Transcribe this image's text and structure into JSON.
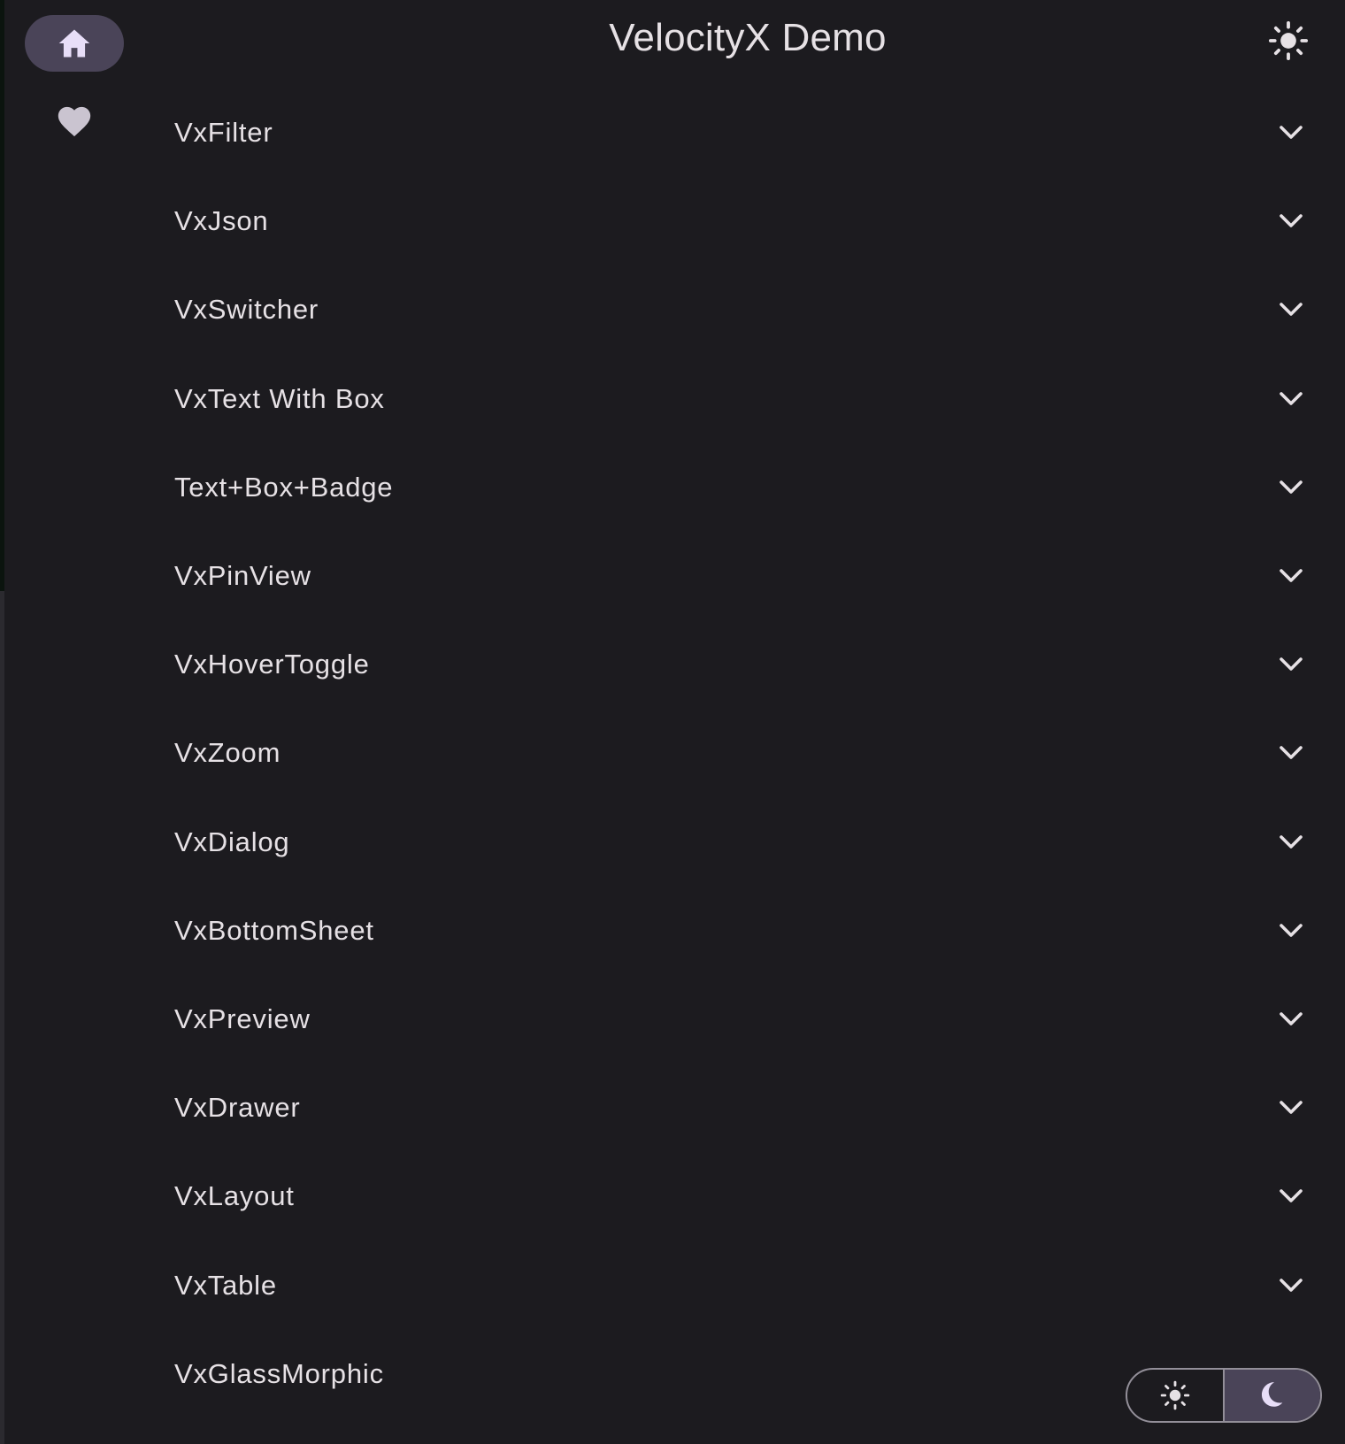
{
  "app": {
    "title": "VelocityX Demo"
  },
  "nav_rail": {
    "items": [
      {
        "icon": "home-icon",
        "selected": true
      },
      {
        "icon": "heart-icon",
        "selected": false
      }
    ]
  },
  "header": {
    "theme_icon": "sun-icon"
  },
  "list": {
    "items": [
      {
        "label": "VxFilter"
      },
      {
        "label": "VxJson"
      },
      {
        "label": "VxSwitcher"
      },
      {
        "label": "VxText With Box"
      },
      {
        "label": "Text+Box+Badge"
      },
      {
        "label": "VxPinView"
      },
      {
        "label": "VxHoverToggle"
      },
      {
        "label": "VxZoom"
      },
      {
        "label": "VxDialog"
      },
      {
        "label": "VxBottomSheet"
      },
      {
        "label": "VxPreview"
      },
      {
        "label": "VxDrawer"
      },
      {
        "label": "VxLayout"
      },
      {
        "label": "VxTable"
      },
      {
        "label": "VxGlassMorphic"
      }
    ]
  },
  "theme_toggle": {
    "options": [
      {
        "icon": "sun-icon",
        "selected": false
      },
      {
        "icon": "moon-icon",
        "selected": true
      }
    ]
  },
  "colors": {
    "background": "#1c1b1f",
    "text": "#e6e1e5",
    "selected_indicator": "#4a4458",
    "icon_muted": "#cac4d0",
    "outline": "#938f99"
  }
}
